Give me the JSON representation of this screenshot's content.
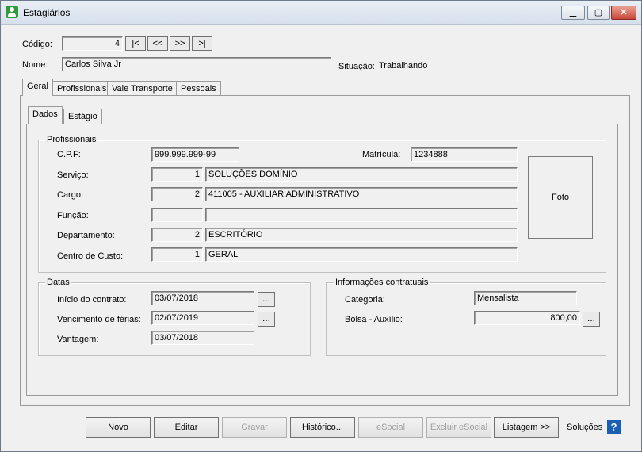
{
  "window": {
    "title": "Estagiários",
    "minimize_glyph": "▁",
    "maximize_glyph": "▢",
    "close_glyph": "✕"
  },
  "header": {
    "codigo_label": "Código:",
    "codigo_value": "4",
    "nav": [
      "|<",
      "<<",
      ">>",
      ">|"
    ],
    "nome_label": "Nome:",
    "nome_value": "Carlos Silva Jr",
    "situacao_label": "Situação:",
    "situacao_value": "Trabalhando"
  },
  "tabs": [
    "Geral",
    "Profissionais",
    "Vale Transporte",
    "Pessoais"
  ],
  "subtabs": [
    "Dados",
    "Estágio"
  ],
  "profissionais": {
    "title": "Profissionais",
    "cpf_label": "C.P.F:",
    "cpf_value": "999.999.999-99",
    "matricula_label": "Matrícula:",
    "matricula_value": "1234888",
    "servico_label": "Serviço:",
    "servico_code": "1",
    "servico_value": "SOLUÇÕES DOMÍNIO",
    "cargo_label": "Cargo:",
    "cargo_code": "2",
    "cargo_value": "411005 - AUXILIAR ADMINISTRATIVO",
    "funcao_label": "Função:",
    "funcao_code": "",
    "funcao_value": "",
    "departamento_label": "Departamento:",
    "departamento_code": "2",
    "departamento_value": "ESCRITÓRIO",
    "centro_label": "Centro de Custo:",
    "centro_code": "1",
    "centro_value": "GERAL",
    "foto_label": "Foto"
  },
  "datas": {
    "title": "Datas",
    "inicio_label": "Início do contrato:",
    "inicio_value": "03/07/2018",
    "vencimento_label": "Vencimento de férias:",
    "vencimento_value": "02/07/2019",
    "vantagem_label": "Vantagem:",
    "vantagem_value": "03/07/2018",
    "ellipsis": "..."
  },
  "contratuais": {
    "title": "Informações contratuais",
    "categoria_label": "Categoria:",
    "categoria_value": "Mensalista",
    "bolsa_label": "Bolsa - Auxílio:",
    "bolsa_value": "800,00",
    "ellipsis": "..."
  },
  "buttons": {
    "novo": "Novo",
    "editar": "Editar",
    "gravar": "Gravar",
    "historico": "Histórico...",
    "esocial": "eSocial",
    "excluir_esocial": "Excluir eSocial",
    "listagem": "Listagem >>",
    "solucoes": "Soluções",
    "help": "?"
  }
}
